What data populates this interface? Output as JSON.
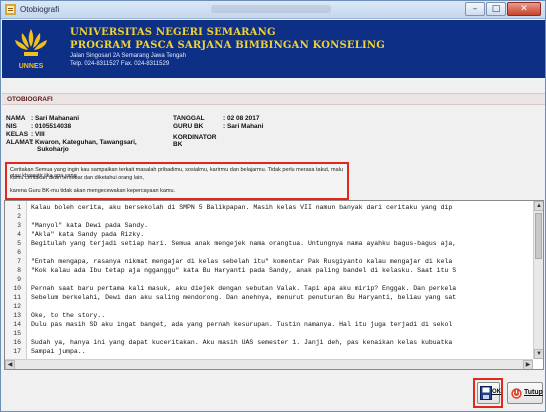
{
  "window": {
    "title": "Otobiografi"
  },
  "header": {
    "logo_text": "UNNES",
    "university": "UNIVERSITAS NEGERI SEMARANG",
    "program": "PROGRAM PASCA SARJANA BIMBINGAN KONSELING",
    "address": "Jalan Singosari 2A Semarang Jawa Tengah",
    "phone": "Telp. 024-8311527 Fax. 024-8311529"
  },
  "section_title": "OTOBIOGRAFI",
  "info": {
    "nama_label": "NAMA",
    "nama_value": ": Sari Mahanani",
    "nis_label": "NIS",
    "nis_value": ": 0105514038",
    "kelas_label": "KELAS",
    "kelas_value": ": VIII",
    "alamat_label": "ALAMAT",
    "alamat_value": ": Kwaron, Kateguhan, Tawangsari,",
    "alamat_value2": "Sukoharjo",
    "tanggal_label": "TANGGAL",
    "tanggal_value": ": 02 08 2017",
    "gurubk_label": "GURU BK",
    "gurubk_value": ": Sari Mahani",
    "koordinator_label": "KORDINATOR",
    "koordinator_value": "BK"
  },
  "message": {
    "line1": "Ceritakan Semua yang ingin kau sampaikan terkait masalah pribadimu, sosialmu, karirmu dan belajarmu. Tidak perlu merasa takut, malu atau khawatir jika apa yang",
    "line2": "kamu ceritakan akan tersebar dan diketahui orang lain,",
    "line3": "karena Guru BK-mu tidak akan mengecewakan kepercayaan kamu."
  },
  "editor": {
    "lines": [
      {
        "n": "1",
        "text": "Kalau boleh cerita, aku bersekolah di SMPN 5 Balikpapan. Masih kelas VII namun banyak dari ceritaku yang dip"
      },
      {
        "n": "2",
        "text": ""
      },
      {
        "n": "3",
        "text": "\"Manyol\" kata Dewi pada Sandy."
      },
      {
        "n": "4",
        "text": "\"Akla\" kata Sandy pada Rizky."
      },
      {
        "n": "5",
        "text": "Begitulah yang terjadi setiap hari. Semua anak mengejek nama orangtua. Untungnya nama ayahku bagus-bagus aja,"
      },
      {
        "n": "6",
        "text": ""
      },
      {
        "n": "7",
        "text": "\"Entah mengapa, rasanya nikmat mengajar di kelas sebelah itu\" komentar Pak Rusgiyanto kalau mengajar di kela"
      },
      {
        "n": "8",
        "text": "\"Kok kalau ada Ibu tetap aja ngganggu\" kata Bu Haryanti pada Sandy, anak paling bandel di kelasku. Saat itu S"
      },
      {
        "n": "9",
        "text": ""
      },
      {
        "n": "10",
        "text": "Pernah saat baru pertama kali masuk, aku diejek dengan sebutan Valak. Tapi apa aku mirip? Enggak. Dan perkela"
      },
      {
        "n": "11",
        "text": "Sebelum berkelahi, Dewi dan aku saling mendorong. Dan anehnya, menurut penuturan Bu Haryanti, beliau yang sat"
      },
      {
        "n": "12",
        "text": ""
      },
      {
        "n": "13",
        "text": "Oke, to the story.."
      },
      {
        "n": "14",
        "text": "Dulu pas masih SD aku ingat banget, ada yang pernah kesurupan. Tustin namanya. Hal itu juga terjadi di sekol"
      },
      {
        "n": "15",
        "text": ""
      },
      {
        "n": "16",
        "text": "Sudah ya, hanya ini yang dapat kuceritakan. Aku masih UAS semester 1. Janji deh, pas kenaikan kelas kubuatka"
      },
      {
        "n": "17",
        "text": "Sampai jumpa.."
      }
    ]
  },
  "buttons": {
    "ok": "OK",
    "tutup": "Tutup"
  },
  "colors": {
    "header_bg": "#0e2f86",
    "header_text": "#f0d230",
    "highlight": "#e0281c"
  }
}
